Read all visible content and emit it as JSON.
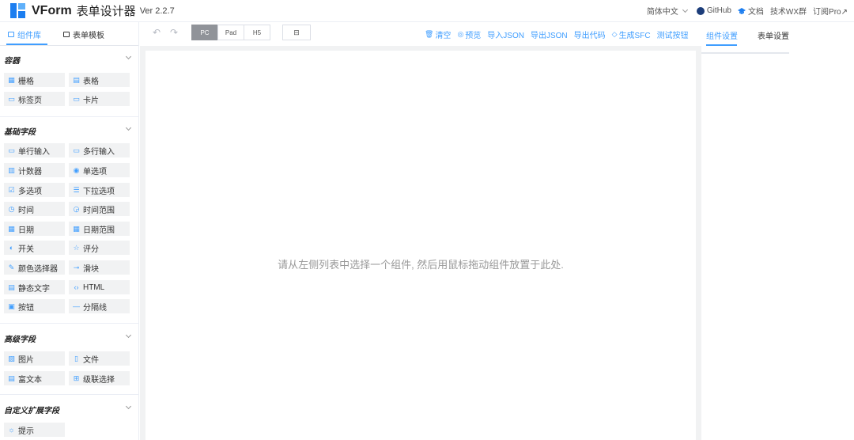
{
  "header": {
    "brand": "VForm",
    "subtitle": "表单设计器",
    "version": "Ver 2.2.7",
    "language": "简体中文",
    "links": [
      "GitHub",
      "文档",
      "技术WX群",
      "订阅Pro↗"
    ]
  },
  "left": {
    "tabs": [
      "组件库",
      "表单模板"
    ],
    "groups": [
      {
        "title": "容器",
        "items": [
          "栅格",
          "表格",
          "标签页",
          "卡片"
        ]
      },
      {
        "title": "基础字段",
        "items": [
          "单行输入",
          "多行输入",
          "计数器",
          "单选项",
          "多选项",
          "下拉选项",
          "时间",
          "时间范围",
          "日期",
          "日期范围",
          "开关",
          "评分",
          "颜色选择器",
          "滑块",
          "静态文字",
          "HTML",
          "按钮",
          "分隔线"
        ]
      },
      {
        "title": "高级字段",
        "items": [
          "图片",
          "文件",
          "富文本",
          "级联选择"
        ]
      },
      {
        "title": "自定义扩展字段",
        "items": [
          "提示"
        ]
      }
    ]
  },
  "toolbar": {
    "undo_icon": "↶",
    "redo_icon": "↷",
    "devices": [
      "PC",
      "Pad",
      "H5"
    ],
    "tree_icon": "⊟",
    "actions": [
      {
        "icon": "🗑",
        "label": "清空"
      },
      {
        "icon": "◎",
        "label": "预览"
      },
      {
        "icon": "",
        "label": "导入JSON"
      },
      {
        "icon": "",
        "label": "导出JSON"
      },
      {
        "icon": "",
        "label": "导出代码"
      },
      {
        "icon": "◇",
        "label": "生成SFC"
      },
      {
        "icon": "",
        "label": "测试按钮"
      }
    ]
  },
  "canvas": {
    "hint": "请从左侧列表中选择一个组件, 然后用鼠标拖动组件放置于此处."
  },
  "right": {
    "tabs": [
      "组件设置",
      "表单设置"
    ]
  },
  "colors": {
    "accent": "#409eff",
    "canvas_bg": "#f1f2f3",
    "item_bg": "#f1f2f3"
  }
}
